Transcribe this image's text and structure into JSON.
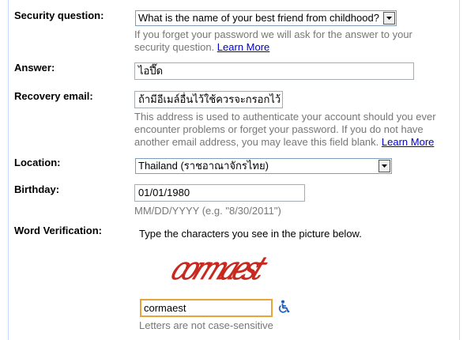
{
  "form": {
    "security_question": {
      "label": "Security question:",
      "selected": "What is the name of your best friend from childhood?",
      "help_1": "If you forget your password we will ask for the answer to your",
      "help_2": "security question.",
      "learn_more": "Learn More"
    },
    "answer": {
      "label": "Answer:",
      "value": "ไอปึ๊ด"
    },
    "recovery_email": {
      "label": "Recovery email:",
      "value": "ถ้ามีอีเมล์อื่นไว้ใช้ควรจะกรอกไว้",
      "help_1": "This address is used to authenticate your account should you ever",
      "help_2": "encounter problems or forget your password. If you do not have",
      "help_3": "another email address, you may leave this field blank.",
      "learn_more": "Learn More"
    },
    "location": {
      "label": "Location:",
      "selected": "Thailand (ราชอาณาจักรไทย)"
    },
    "birthday": {
      "label": "Birthday:",
      "value": "01/01/1980",
      "hint": "MM/DD/YYYY (e.g. \"8/30/2011\")"
    },
    "word_verification": {
      "label": "Word Verification:",
      "instruction": "Type the characters you see in the picture below.",
      "captcha_text": "cormaest",
      "value": "cormaest",
      "note": "Letters are not case-sensitive",
      "accessibility_icon": "wheelchair-accessibility-icon"
    }
  },
  "colors": {
    "label_text": "#000000",
    "help_text": "#777777",
    "link": "#0000cc",
    "captcha_red": "#c8281e",
    "focus_border": "#e8a33a",
    "accessibility_icon": "#1a5fb4",
    "frame_border": "#c3d9ff"
  }
}
